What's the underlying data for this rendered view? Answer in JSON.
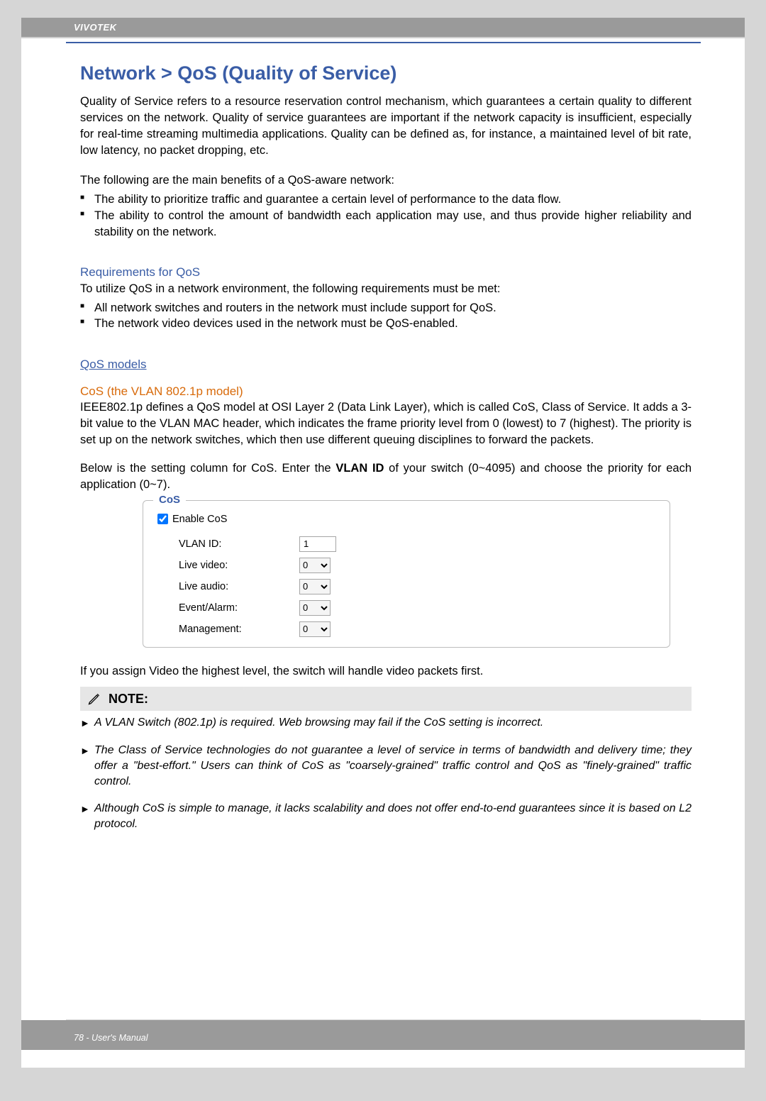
{
  "header": {
    "brand": "VIVOTEK"
  },
  "title": "Network > QoS (Quality of Service)",
  "intro": "Quality of Service refers to a resource reservation control mechanism, which guarantees a certain quality to different services on the network. Quality of service guarantees are important if the network capacity is insufficient, especially for real-time streaming multimedia applications. Quality can be defined as, for instance, a maintained level of bit rate, low latency, no packet dropping, etc.",
  "benefitsLead": "The following are the main benefits of a QoS-aware network:",
  "benefits": [
    "The ability to prioritize traffic and guarantee a certain level of performance to the data flow.",
    "The ability to control the amount of bandwidth each application may use, and thus provide higher reliability and stability on the network."
  ],
  "reqTitle": "Requirements for QoS",
  "reqLead": "To utilize QoS in a network environment, the following requirements must be met:",
  "reqs": [
    "All network switches and routers in the network must include support for QoS.",
    "The network video devices used in the network must be QoS-enabled."
  ],
  "modelsTitle": "QoS models",
  "cosTitle": "CoS (the VLAN 802.1p model)",
  "cosDesc": "IEEE802.1p defines a QoS model at OSI Layer 2 (Data Link Layer), which is called CoS, Class of Service. It adds a 3-bit value to the VLAN MAC header, which indicates the frame priority level from 0 (lowest) to 7 (highest). The priority is set up on the network switches, which then use different queuing disciplines to forward the packets.",
  "cosLead1": "Below is the setting column for CoS. Enter the ",
  "cosLeadBold": "VLAN ID",
  "cosLead2": " of your switch (0~4095) and choose the priority for each application (0~7).",
  "cosBox": {
    "legend": "CoS",
    "enableLabel": "Enable CoS",
    "enableChecked": true,
    "rows": {
      "vlanIdLabel": "VLAN ID:",
      "vlanIdValue": "1",
      "liveVideoLabel": "Live video:",
      "liveVideoValue": "0",
      "liveAudioLabel": "Live audio:",
      "liveAudioValue": "0",
      "eventLabel": "Event/Alarm:",
      "eventValue": "0",
      "mgmtLabel": "Management:",
      "mgmtValue": "0"
    }
  },
  "afterBox": "If you assign Video the highest level, the switch will handle video packets first.",
  "noteHeader": "NOTE:",
  "notes": [
    "A VLAN Switch (802.1p) is required. Web browsing may fail if the CoS setting is incorrect.",
    "The Class of Service technologies do not guarantee a level of service in terms of bandwidth and delivery time; they offer a \"best-effort.\" Users can think of CoS as \"coarsely-grained\" traffic control and QoS as \"finely-grained\" traffic control.",
    "Although CoS is simple to manage, it lacks scalability and does not offer end-to-end guarantees since it is based on L2 protocol."
  ],
  "footer": "78 - User's Manual"
}
